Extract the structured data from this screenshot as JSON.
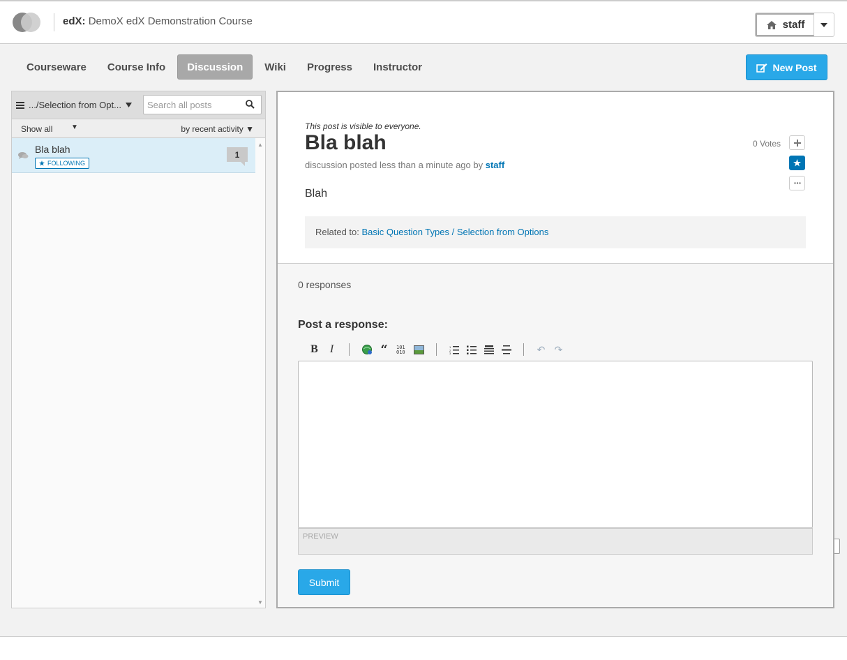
{
  "header": {
    "brand": "edX:",
    "course": "DemoX edX Demonstration Course",
    "user": "staff"
  },
  "tabs": [
    {
      "label": "Courseware"
    },
    {
      "label": "Course Info"
    },
    {
      "label": "Discussion",
      "active": true
    },
    {
      "label": "Wiki"
    },
    {
      "label": "Progress"
    },
    {
      "label": "Instructor"
    }
  ],
  "new_post": "New Post",
  "sidebar": {
    "topic": ".../Selection from Opt...",
    "search_placeholder": "Search all posts",
    "filter": "Show all",
    "sort": "by recent activity",
    "threads": [
      {
        "title": "Bla blah",
        "badge": "FOLLOWING",
        "count": "1"
      }
    ]
  },
  "post": {
    "visibility": "This post is visible to everyone.",
    "title": "Bla blah",
    "meta": "discussion posted less than a minute ago by",
    "author": "staff",
    "votes": "0 Votes",
    "body": "Blah",
    "related_label": "Related to:",
    "related_link": "Basic Question Types / Selection from Options"
  },
  "responses": {
    "count": "0 responses",
    "label": "Post a response:",
    "preview": "PREVIEW",
    "submit": "Submit"
  },
  "icons": {
    "home": "home-icon",
    "edit": "edit-icon",
    "search": "search-icon",
    "star": "star-icon"
  },
  "colors": {
    "accent": "#29a8e8",
    "link": "#0075b4",
    "selected_thread": "#dbeef8"
  }
}
